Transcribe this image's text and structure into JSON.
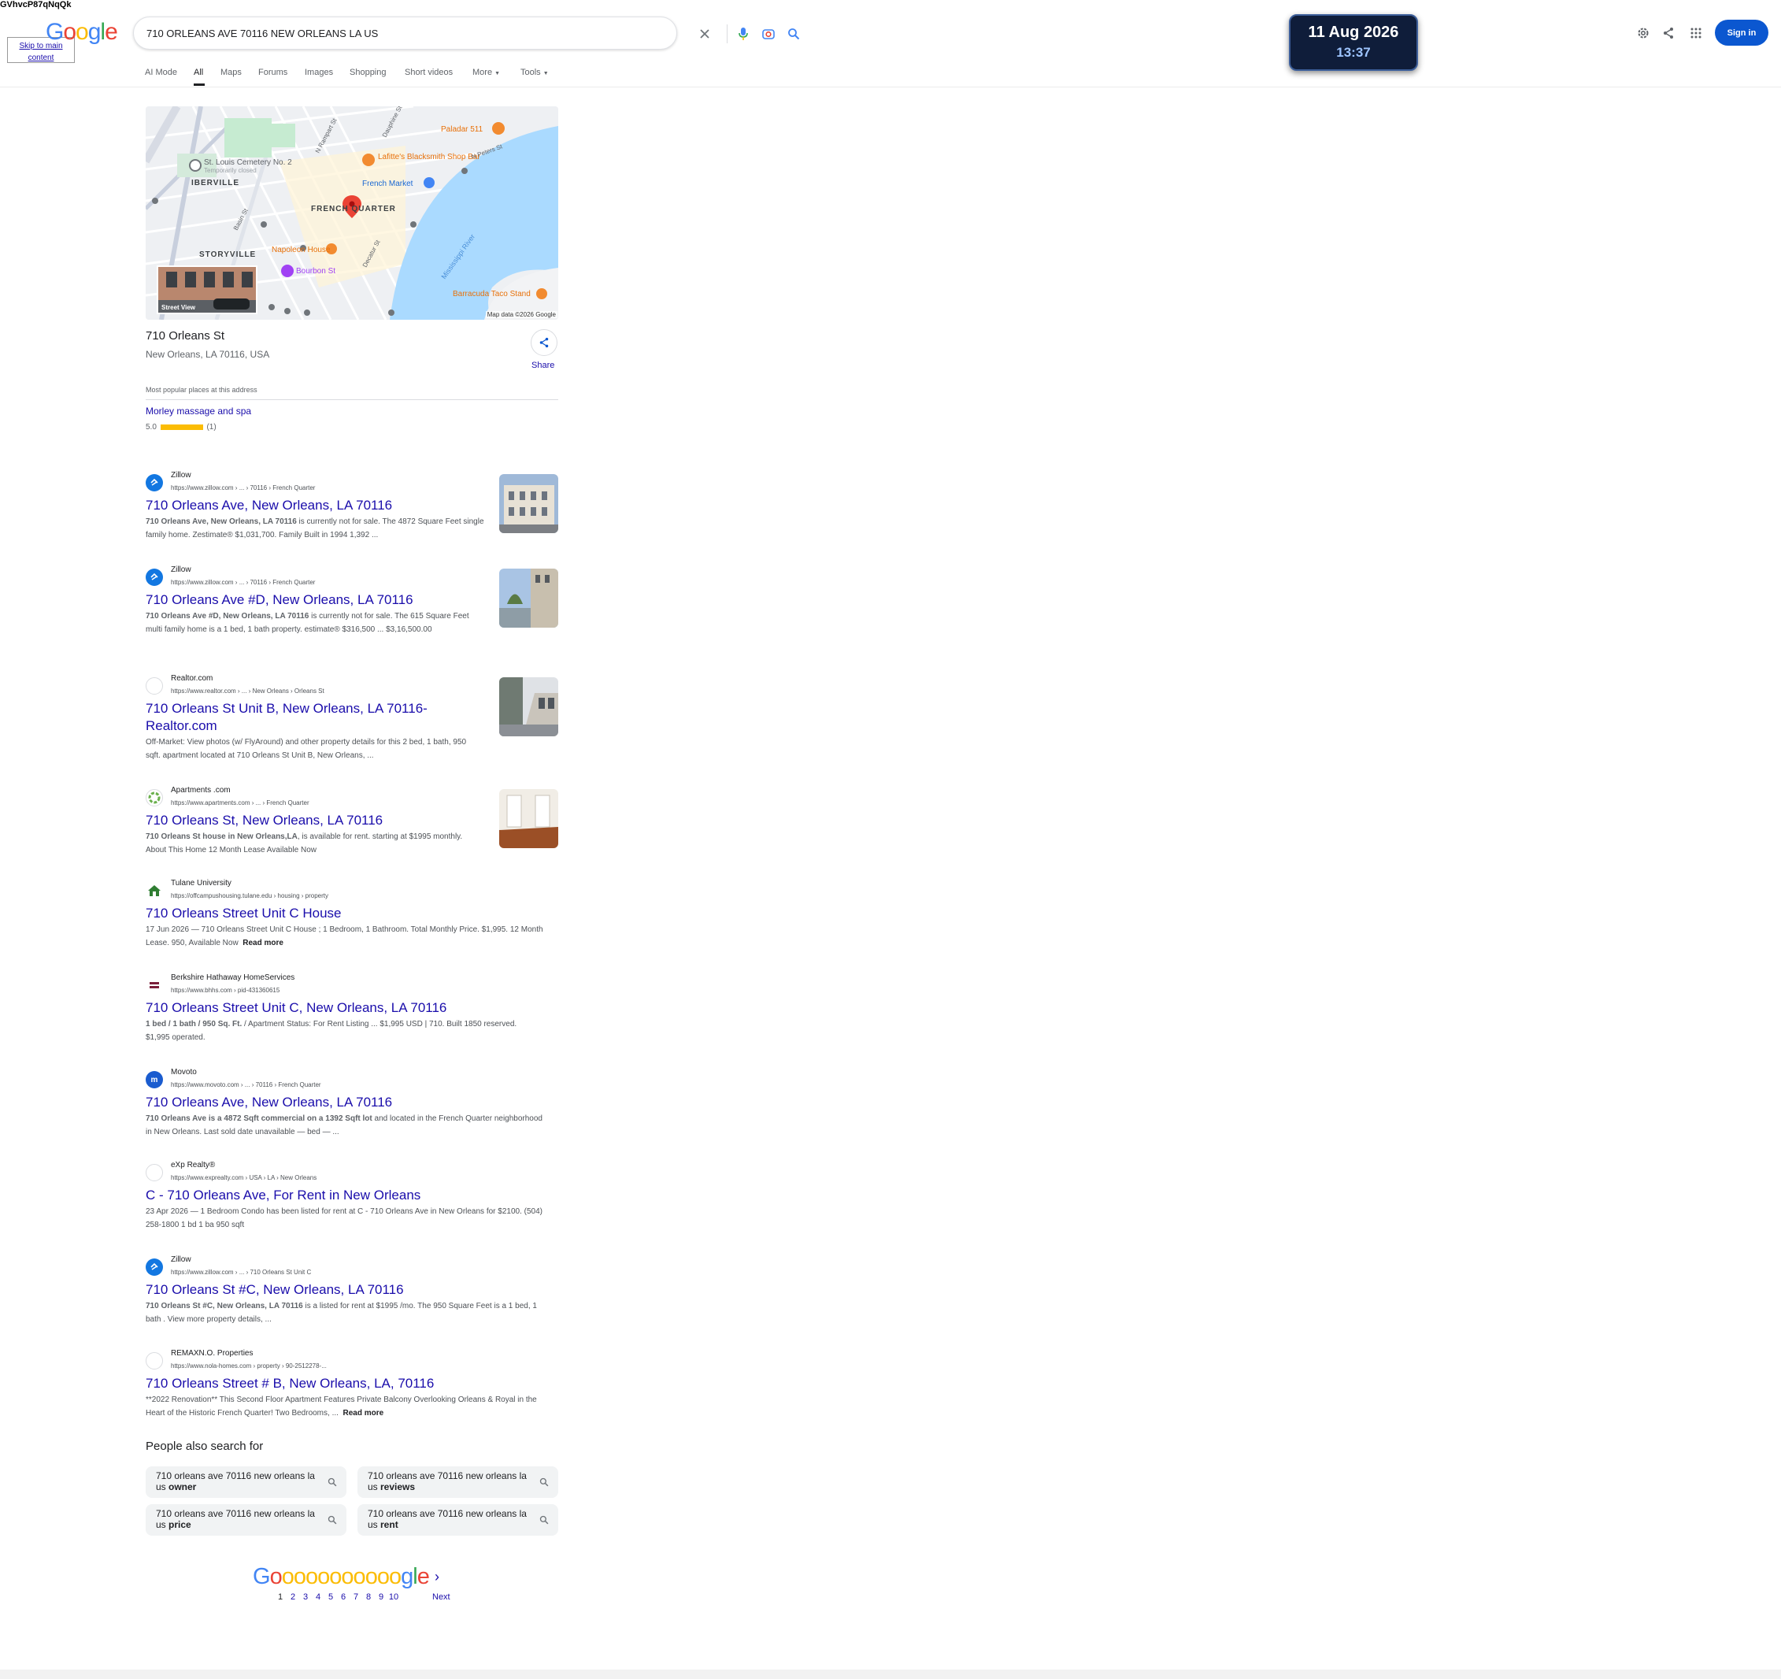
{
  "header": {
    "overlap_text": "GVhvcP87qNqQk",
    "skip_links": "Skip to main content",
    "logo_letters": [
      "G",
      "o",
      "o",
      "g",
      "l",
      "e"
    ],
    "search_value": "710 ORLEANS AVE 70116 NEW ORLEANS LA US",
    "sign_in": "Sign in"
  },
  "clock": {
    "date": "11 Aug 2026",
    "time": "13:37"
  },
  "tabs": [
    "AI Mode",
    "All",
    "Maps",
    "Forums",
    "Images",
    "Shopping",
    "Short videos",
    "More",
    "Tools"
  ],
  "map": {
    "labels": {
      "cemetery": "St. Louis Cemetery No. 2",
      "cemetery_status": "Temporarily closed",
      "iberville": "IBERVILLE",
      "french_quarter": "FRENCH QUARTER",
      "storyville": "STORYVILLE",
      "paladar": "Paladar 511",
      "lafittes": "Lafitte's Blacksmith Shop Bar",
      "french_market": "French Market",
      "napoleon": "Napoleon House",
      "bourbon": "Bourbon St",
      "barracuda": "Barracuda Taco Stand",
      "river": "Mississippi River",
      "n_rampart": "N Rampart St",
      "n_peters": "N Peters St",
      "decatur": "Decatur St",
      "basin": "Basin St",
      "dauphine": "Dauphine St",
      "street_view": "Street View"
    },
    "attribution": "Map data ©2026 Google"
  },
  "place": {
    "title": "710 Orleans St",
    "address": "New Orleans, LA 70116, USA",
    "share": "Share",
    "popular_heading": "Most popular places at this address",
    "popular_name": "Morley massage and spa",
    "popular_rating": "5.0",
    "popular_count": "(1)"
  },
  "results": [
    {
      "site": "Zillow",
      "url": "https://www.zillow.com › ... › 70116 › French Quarter",
      "title": "710 Orleans Ave, New Orleans, LA 70116",
      "snippet_bold": "710 Orleans Ave, New Orleans, LA 70116",
      "snippet": " is currently not for sale. The 4872 Square Feet single family home. Zestimate® $1,031,700. Family Built in 1994 1,392 ..."
    },
    {
      "site": "Zillow",
      "url": "https://www.zillow.com › ... › 70116 › French Quarter",
      "title": "710 Orleans Ave #D, New Orleans, LA 70116",
      "snippet_bold": "710 Orleans Ave #D, New Orleans, LA 70116",
      "snippet": " is currently not for sale. The 615 Square Feet multi family home is a 1 bed, 1 bath property. estimate® $316,500 ... $3,16,500.00"
    },
    {
      "site": "Realtor.com",
      "url": "https://www.realtor.com › ... › New Orleans › Orleans St",
      "title": "710 Orleans St Unit B, New Orleans, LA 70116- Realtor.com",
      "snippet_bold": "",
      "snippet": "Off-Market: View photos (w/ FlyAround) and other property details for this 2 bed, 1 bath, 950 sqft. apartment located at 710 Orleans St Unit B, New Orleans, ..."
    },
    {
      "site": "Apartments .com",
      "url": "https://www.apartments.com › ... › French Quarter",
      "title": "710 Orleans St, New Orleans, LA 70116",
      "snippet_bold": "710 Orleans St house in New Orleans,LA",
      "snippet": ", is available for rent. starting at $1995 monthly. About This Home 12 Month Lease Available Now"
    },
    {
      "site": "Tulane University",
      "url": "https://offcampushousing.tulane.edu › housing › property",
      "title": "710 Orleans Street Unit C House",
      "snippet_bold": "",
      "snippet": "17 Jun 2026 — 710 Orleans Street Unit C House ; 1 Bedroom, 1 Bathroom. Total Monthly Price. $1,995. 12 Month Lease. 950, Available Now",
      "readmore": "Read more"
    },
    {
      "site": "Berkshire Hathaway HomeServices",
      "url": "https://www.bhhs.com › pid-431360615",
      "title": "710 Orleans Street Unit C, New Orleans, LA 70116",
      "snippet_bold": "1 bed / 1 bath / 950 Sq. Ft.",
      "snippet": " / Apartment Status: For Rent Listing ... $1,995 USD | 710. Built 1850 reserved. $1,995 operated."
    },
    {
      "site": "Movoto",
      "url": "https://www.movoto.com › ... › 70116 › French Quarter",
      "title": "710 Orleans Ave, New Orleans, LA 70116",
      "snippet_bold": "710 Orleans Ave is a 4872 Sqft commercial on a 1392 Sqft lot",
      "snippet": " and located in the French Quarter neighborhood in New Orleans. Last sold date unavailable — bed — ..."
    },
    {
      "site": "eXp Realty®",
      "url": "https://www.exprealty.com › USA › LA › New Orleans",
      "title": "C - 710 Orleans Ave, For Rent in New Orleans",
      "snippet_bold": "",
      "snippet": "23 Apr 2026 — 1 Bedroom Condo has been listed for rent at C - 710 Orleans Ave in New Orleans for $2100. (504) 258-1800 1 bd 1 ba 950 sqft"
    },
    {
      "site": "Zillow",
      "url": "https://www.zillow.com › ... › 710 Orleans St Unit C",
      "title": "710 Orleans St #C, New Orleans, LA 70116",
      "snippet_bold": "710 Orleans St #C, New Orleans, LA 70116",
      "snippet": " is a listed for rent at $1995 /mo. The 950 Square Feet is a 1 bed, 1 bath . View more property details, ..."
    },
    {
      "site": "REMAXN.O. Properties",
      "url": "https://www.nola-homes.com › property › 90-2512278-...",
      "title": "710 Orleans Street # B, New Orleans, LA, 70116",
      "snippet_bold": "",
      "snippet": "**2022 Renovation** This Second Floor Apartment Features Private Balcony Overlooking Orleans & Royal in the Heart of the Historic French Quarter! Two Bedrooms, ...",
      "readmore": "Read more"
    }
  ],
  "people_also_search": {
    "heading": "People also search for",
    "items": [
      {
        "prefix": "710 orleans ave 70116 new orleans la us ",
        "bold": "owner"
      },
      {
        "prefix": "710 orleans ave 70116 new orleans la us ",
        "bold": "reviews"
      },
      {
        "prefix": "710 orleans ave 70116 new orleans la us ",
        "bold": "price"
      },
      {
        "prefix": "710 orleans ave 70116 new orleans la us ",
        "bold": "rent"
      }
    ]
  },
  "pager": {
    "logo": "Gooooooooooogle",
    "pages": [
      "1",
      "2",
      "3",
      "4",
      "5",
      "6",
      "7",
      "8",
      "9",
      "10"
    ],
    "next": "Next"
  },
  "colors": {
    "link": "#1a0dab",
    "accent": "#0b57d0",
    "star": "#fbbc04",
    "river": "#aadaff"
  }
}
